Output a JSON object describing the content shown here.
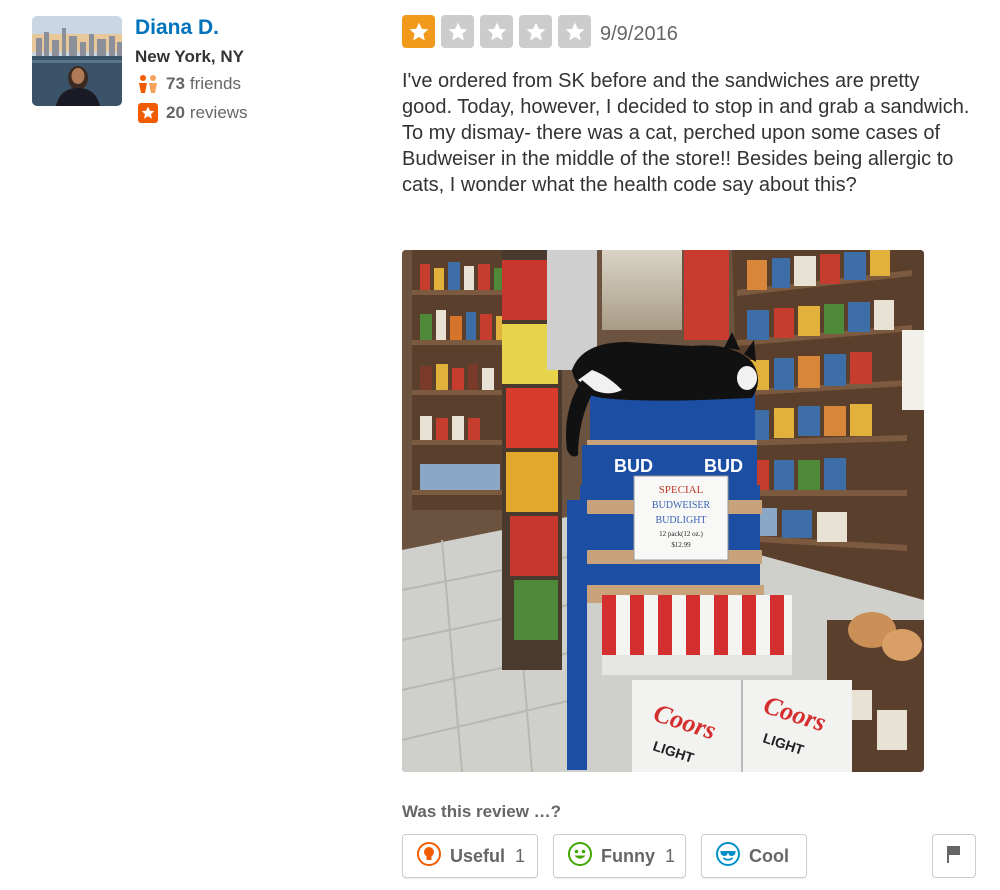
{
  "user": {
    "name": "Diana D.",
    "location": "New York, NY",
    "friends_count": "73",
    "friends_label": "friends",
    "reviews_count": "20",
    "reviews_label": "reviews"
  },
  "review": {
    "rating": 1,
    "rating_max": 5,
    "date": "9/9/2016",
    "text": "I've ordered from SK before and the sandwiches are pretty good. Today, however, I decided to stop in and grab a sandwich. To my dismay- there was a cat, perched upon some cases of Budweiser in the middle of the store!! Besides being allergic to cats, I wonder what the health code say about this?"
  },
  "photo": {
    "sign_lines": [
      "SPECIAL",
      "BUDWEISER",
      "BUDLIGHT",
      "12 pack(12 oz.)",
      "$12.99"
    ],
    "box_brand": "BUD",
    "coors_brand": "Coors",
    "coors_light": "LIGHT"
  },
  "votes": {
    "prompt": "Was this review …?",
    "useful": {
      "label": "Useful",
      "count": "1"
    },
    "funny": {
      "label": "Funny",
      "count": "1"
    },
    "cool": {
      "label": "Cool",
      "count": ""
    }
  },
  "colors": {
    "link": "#0073bb",
    "star_on": "#f0991b",
    "star_off": "#cccccc",
    "useful": "#f15c00",
    "funny": "#41a700",
    "cool": "#0090c9",
    "friends_icon": "#f15c00",
    "reviews_icon": "#f15c00"
  },
  "icons": {
    "friends": "friends-icon",
    "reviews": "review-star-icon",
    "star": "star-icon",
    "useful": "lightbulb-icon",
    "funny": "smile-icon",
    "cool": "sunglasses-icon",
    "flag": "flag-icon"
  }
}
